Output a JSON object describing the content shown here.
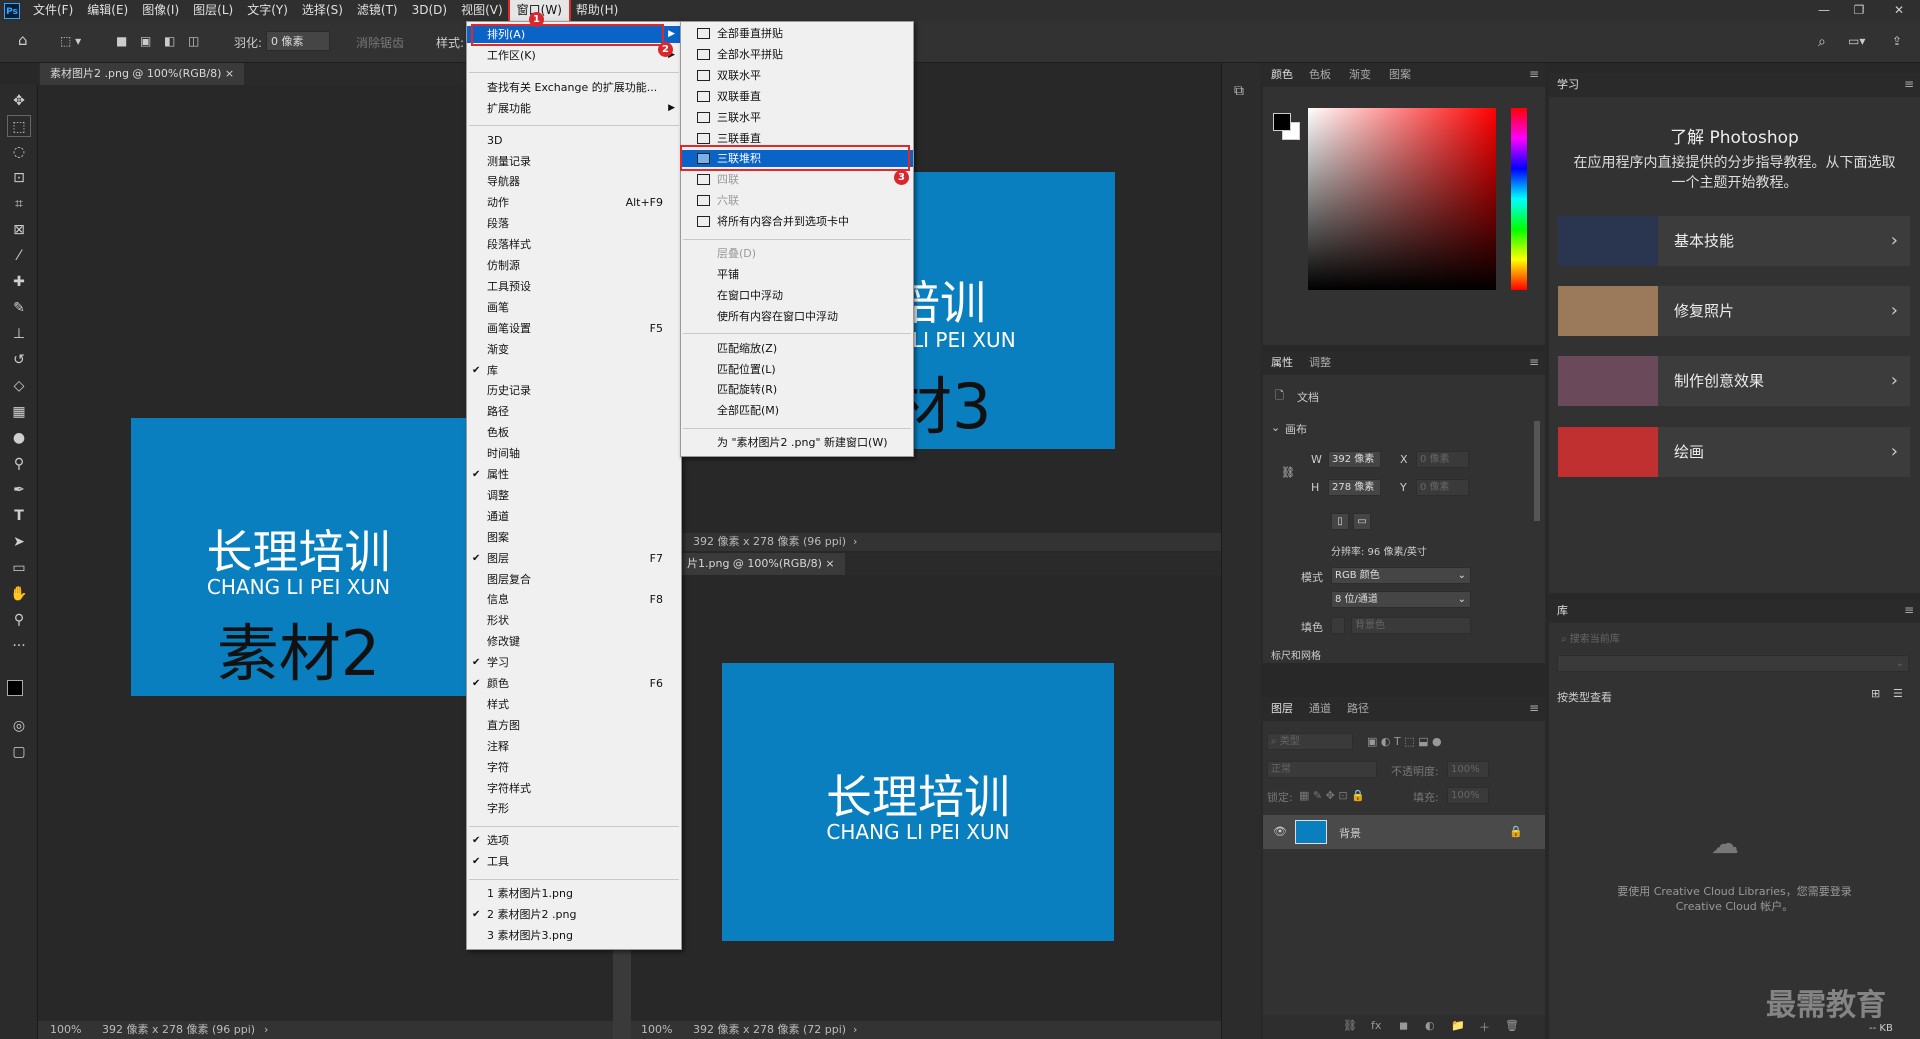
{
  "menubar": {
    "logo": "Ps",
    "items": [
      "文件(F)",
      "编辑(E)",
      "图像(I)",
      "图层(L)",
      "文字(Y)",
      "选择(S)",
      "滤镜(T)",
      "3D(D)",
      "视图(V)",
      "窗口(W)",
      "帮助(H)"
    ],
    "window_controls": [
      "—",
      "❐",
      "✕"
    ]
  },
  "optbar": {
    "feather_label": "羽化:",
    "feather_value": "0 像素",
    "antialias_label": "消除锯齿",
    "style_label": "样式:"
  },
  "documents": {
    "left_tab": "素材图片2 .png @ 100%(RGB/8)",
    "left_tab_close": "×",
    "left_status_zoom": "100%",
    "left_status_info": "392 像素 x 278 像素 (96 ppi)",
    "left_title": "长理培训",
    "left_subtitle": "CHANG LI PEI XUN",
    "left_big": "素材2",
    "top_right_title": "培训",
    "top_right_subtitle": "LI PEI XUN",
    "top_right_big": "材3",
    "top_right_status_info": "392 像素 x 278 像素 (96 ppi)",
    "bottom_tab": "片1.png @ 100%(RGB/8)",
    "bottom_tab_close": "×",
    "bottom_title": "长理培训",
    "bottom_subtitle": "CHANG LI PEI XUN",
    "bottom_status_zoom": "100%",
    "bottom_status_info": "392 像素 x 278 像素 (72 ppi)",
    "status_arrow": "›"
  },
  "window_menu": {
    "items": [
      {
        "label": "排列(A)",
        "arrow": "▶",
        "highlight": true
      },
      {
        "label": "工作区(K)",
        "arrow": "▶"
      },
      {
        "sep": true
      },
      {
        "label": "查找有关 Exchange 的扩展功能..."
      },
      {
        "label": "扩展功能",
        "arrow": "▶"
      },
      {
        "sep": true
      },
      {
        "label": "3D"
      },
      {
        "label": "测量记录"
      },
      {
        "label": "导航器"
      },
      {
        "label": "动作",
        "shortcut": "Alt+F9"
      },
      {
        "label": "段落"
      },
      {
        "label": "段落样式"
      },
      {
        "label": "仿制源"
      },
      {
        "label": "工具预设"
      },
      {
        "label": "画笔"
      },
      {
        "label": "画笔设置",
        "shortcut": "F5"
      },
      {
        "label": "渐变"
      },
      {
        "label": "库",
        "check": "✔"
      },
      {
        "label": "历史记录"
      },
      {
        "label": "路径"
      },
      {
        "label": "色板"
      },
      {
        "label": "时间轴"
      },
      {
        "label": "属性",
        "check": "✔"
      },
      {
        "label": "调整"
      },
      {
        "label": "通道"
      },
      {
        "label": "图案"
      },
      {
        "label": "图层",
        "check": "✔",
        "shortcut": "F7"
      },
      {
        "label": "图层复合"
      },
      {
        "label": "信息",
        "shortcut": "F8"
      },
      {
        "label": "形状"
      },
      {
        "label": "修改键"
      },
      {
        "label": "学习",
        "check": "✔"
      },
      {
        "label": "颜色",
        "check": "✔",
        "shortcut": "F6"
      },
      {
        "label": "样式"
      },
      {
        "label": "直方图"
      },
      {
        "label": "注释"
      },
      {
        "label": "字符"
      },
      {
        "label": "字符样式"
      },
      {
        "label": "字形"
      },
      {
        "sep": true
      },
      {
        "label": "选项",
        "check": "✔"
      },
      {
        "label": "工具",
        "check": "✔"
      },
      {
        "sep": true
      },
      {
        "label": "1 素材图片1.png"
      },
      {
        "label": "2 素材图片2 .png",
        "check": "✔"
      },
      {
        "label": "3 素材图片3.png"
      }
    ]
  },
  "arrange_menu": {
    "items": [
      {
        "label": "全部垂直拼贴",
        "icon": true
      },
      {
        "label": "全部水平拼贴",
        "icon": true
      },
      {
        "label": "双联水平",
        "icon": true
      },
      {
        "label": "双联垂直",
        "icon": true
      },
      {
        "label": "三联水平",
        "icon": true
      },
      {
        "label": "三联垂直",
        "icon": true
      },
      {
        "label": "三联堆积",
        "icon": true,
        "highlight": true
      },
      {
        "label": "四联",
        "icon": true,
        "disabled": true
      },
      {
        "label": "六联",
        "icon": true,
        "disabled": true
      },
      {
        "label": "将所有内容合并到选项卡中",
        "icon": true
      },
      {
        "sep": true
      },
      {
        "label": "层叠(D)",
        "disabled": true
      },
      {
        "label": "平铺"
      },
      {
        "label": "在窗口中浮动"
      },
      {
        "label": "使所有内容在窗口中浮动"
      },
      {
        "sep": true
      },
      {
        "label": "匹配缩放(Z)"
      },
      {
        "label": "匹配位置(L)"
      },
      {
        "label": "匹配旋转(R)"
      },
      {
        "label": "全部匹配(M)"
      },
      {
        "sep": true
      },
      {
        "label": "为 \"素材图片2 .png\" 新建窗口(W)"
      }
    ]
  },
  "callouts": [
    "1",
    "2",
    "3"
  ],
  "color_panel": {
    "tabs": [
      "颜色",
      "色板",
      "渐变",
      "图案"
    ]
  },
  "properties_panel": {
    "tabs": [
      "属性",
      "调整"
    ],
    "doc_label": "文档",
    "section": "画布",
    "w_label": "W",
    "w_value": "392 像素",
    "h_label": "H",
    "h_value": "278 像素",
    "x_label": "X",
    "x_value": "0 像素",
    "y_label": "Y",
    "y_value": "0 像素",
    "resolution": "分辨率: 96 像素/英寸",
    "mode_label": "模式",
    "mode_value": "RGB 颜色",
    "depth_value": "8 位/通道",
    "fill_label": "填色",
    "fill_value": "背景色",
    "next_section": "标尺和网格"
  },
  "layers_panel": {
    "tabs": [
      "图层",
      "通道",
      "路径"
    ],
    "kind_placeholder": "类型",
    "blend": "正常",
    "opacity_label": "不透明度:",
    "opacity_value": "100%",
    "lock_label": "锁定:",
    "fill_label": "填充:",
    "fill_value": "100%",
    "layer_name": "背景",
    "footer_icons": [
      "⛓",
      "fx",
      "◼",
      "◐",
      "📁",
      "＋",
      "🗑"
    ]
  },
  "learn_panel": {
    "tab": "学习",
    "title": "了解 Photoshop",
    "desc": "在应用程序内直接提供的分步指导教程。从下面选取一个主题开始教程。",
    "cards": [
      {
        "title": "基本技能",
        "color": "#2a3550"
      },
      {
        "title": "修复照片",
        "color": "#9a7a5a"
      },
      {
        "title": "制作创意效果",
        "color": "#6a4a5a"
      },
      {
        "title": "绘画",
        "color": "#c03030"
      }
    ],
    "chevron": "›"
  },
  "library_panel": {
    "tab": "库",
    "search_placeholder": "搜索当前库",
    "view_label": "按类型查看",
    "cc_msg": "要使用 Creative Cloud Libraries，您需要登录 Creative Cloud 帐户。",
    "kb": "-- KB"
  },
  "watermark": "最需教育"
}
